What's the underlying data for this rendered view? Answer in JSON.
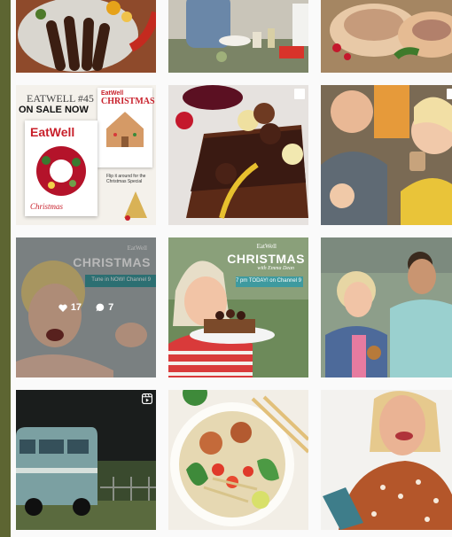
{
  "grid": {
    "posts": [
      {
        "name": "roast-lamb-platter"
      },
      {
        "name": "kitchen-prep-scene"
      },
      {
        "name": "stuffed-roast-pork"
      },
      {
        "name": "magazine-cover-eatwell-45",
        "headline_issue": "EATWELL #45",
        "headline_sale": "ON SALE NOW",
        "cover_brand": "EatWell",
        "back_brand": "EatWell",
        "back_title": "CHRISTMAS",
        "flip_note": "Flip it around for the Christmas Special",
        "cover_label": "Christmas"
      },
      {
        "name": "chocolate-pudding-cake"
      },
      {
        "name": "hosts-drinking-toast"
      },
      {
        "name": "christmas-promo-laughing",
        "brand": "EatWell",
        "title": "CHRISTMAS",
        "tagline": "Tune in NOW! Channel 9",
        "likes": "17",
        "comments": "7"
      },
      {
        "name": "christmas-promo-host-cake",
        "brand": "EatWell",
        "title": "CHRISTMAS",
        "subtitle": "with Emma Dean",
        "tagline": "7 pm TODAY! on Channel 9"
      },
      {
        "name": "hosts-outdoor-hug"
      },
      {
        "name": "vintage-van-field",
        "icon": "reel-icon"
      },
      {
        "name": "noodle-salad-bowl"
      },
      {
        "name": "host-holding-book"
      }
    ]
  },
  "colors": {
    "frame_bg": "#5d6532",
    "page_bg": "#fafafa",
    "teal_banner": "#3e9a9f",
    "eatwell_red": "#c8202b"
  }
}
